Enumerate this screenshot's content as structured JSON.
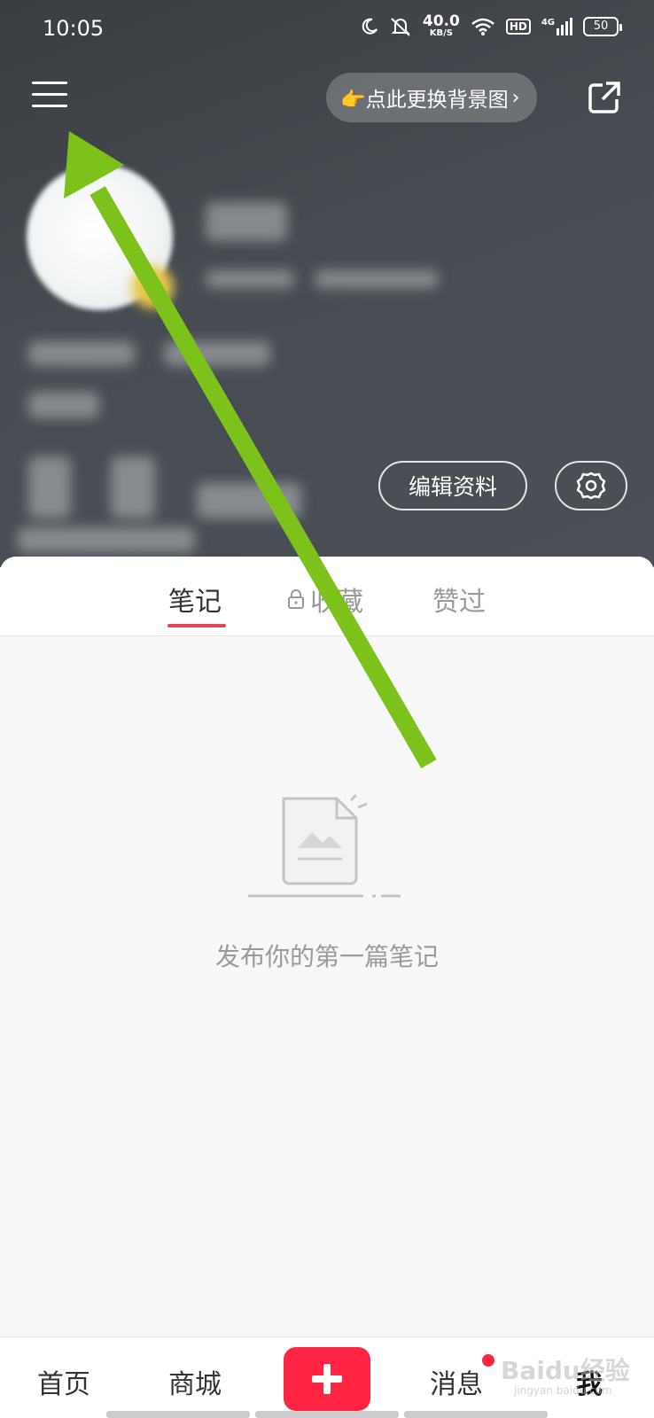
{
  "status_bar": {
    "time": "10:05",
    "network_speed": "40.0",
    "network_unit": "KB/S",
    "hd": "HD",
    "signal": "4G",
    "battery": "50"
  },
  "header": {
    "change_background_label": "👉点此更换背景图",
    "edit_profile_label": "编辑资料"
  },
  "tabs": [
    {
      "label": "笔记",
      "active": true
    },
    {
      "label": "收藏",
      "locked": true
    },
    {
      "label": "赞过"
    }
  ],
  "empty_state": {
    "text": "发布你的第一篇笔记"
  },
  "bottom_nav": {
    "home": "首页",
    "mall": "商城",
    "messages": "消息",
    "me": "我",
    "messages_has_badge": true
  },
  "watermark": {
    "text": "Baidu经验",
    "sub": "jingyan.baidu.com"
  },
  "colors": {
    "accent": "#ff2442",
    "arrow": "#7cc21b"
  },
  "icons": [
    "menu-icon",
    "share-icon",
    "settings-gear-icon",
    "lock-icon",
    "empty-note-icon",
    "plus-icon"
  ]
}
